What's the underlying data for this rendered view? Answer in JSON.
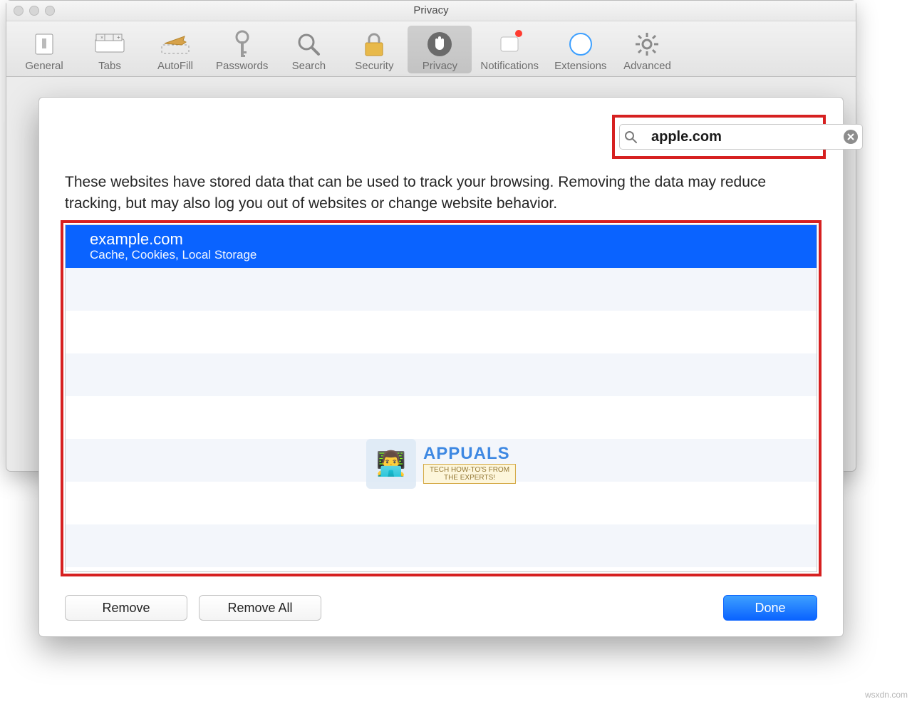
{
  "window": {
    "title": "Privacy"
  },
  "toolbar": {
    "items": [
      {
        "id": "general",
        "label": "General"
      },
      {
        "id": "tabs",
        "label": "Tabs"
      },
      {
        "id": "autofill",
        "label": "AutoFill"
      },
      {
        "id": "passwords",
        "label": "Passwords"
      },
      {
        "id": "search",
        "label": "Search"
      },
      {
        "id": "security",
        "label": "Security"
      },
      {
        "id": "privacy",
        "label": "Privacy",
        "selected": true
      },
      {
        "id": "notifications",
        "label": "Notifications",
        "badge": true
      },
      {
        "id": "extensions",
        "label": "Extensions"
      },
      {
        "id": "advanced",
        "label": "Advanced"
      }
    ]
  },
  "sheet": {
    "search": {
      "value": "apple.com"
    },
    "description": "These websites have stored data that can be used to track your browsing. Removing the data may reduce tracking, but may also log you out of websites or change website behavior.",
    "list": [
      {
        "icon": "apple",
        "domain": "example.com",
        "detail": "Cache, Cookies, Local Storage",
        "selected": true
      }
    ],
    "buttons": {
      "remove": "Remove",
      "remove_all": "Remove All",
      "done": "Done"
    }
  },
  "watermark": {
    "name": "APPUALS",
    "tag1": "TECH HOW-TO'S FROM",
    "tag2": "THE EXPERTS!"
  },
  "source_note": "wsxdn.com"
}
